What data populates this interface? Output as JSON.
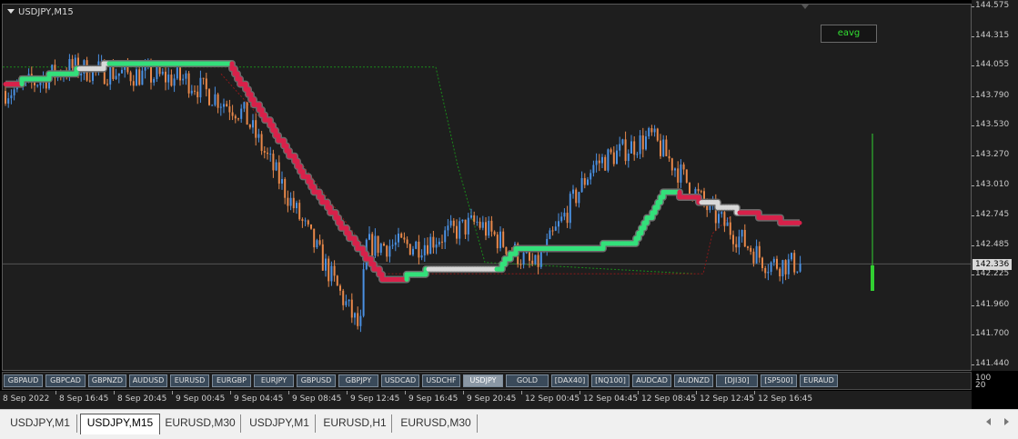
{
  "chart": {
    "title": "USDJPY,M15",
    "indicator_label": "eavg",
    "current_price": "142.336",
    "colors": {
      "background": "#1e1e1e",
      "bull_candle": "#4a90e2",
      "bear_candle": "#e8884a",
      "band_up": "#33e07a",
      "band_down": "#d8214a",
      "band_flat": "#d8d8d8",
      "envelope_green": "#1a8a1a",
      "envelope_red": "#8a1a1a",
      "volume_bar": "#32d032"
    }
  },
  "chart_data": {
    "type": "candlestick",
    "symbol": "USDJPY",
    "timeframe": "M15",
    "ylim": [
      141.44,
      144.575
    ],
    "price_ticks": [
      "144.575",
      "144.315",
      "144.055",
      "143.790",
      "143.530",
      "143.270",
      "143.010",
      "142.745",
      "142.485",
      "142.225",
      "141.960",
      "141.700",
      "141.440"
    ],
    "time_ticks": [
      "8 Sep 2022",
      "8 Sep 16:45",
      "8 Sep 20:45",
      "9 Sep 00:45",
      "9 Sep 04:45",
      "9 Sep 08:45",
      "9 Sep 12:45",
      "9 Sep 16:45",
      "9 Sep 20:45",
      "12 Sep 00:45",
      "12 Sep 04:45",
      "12 Sep 08:45",
      "12 Sep 12:45",
      "12 Sep 16:45"
    ],
    "close_path": [
      [
        "8 Sep 2022",
        143.85
      ],
      [
        "8 Sep 16:45",
        144.05
      ],
      [
        "8 Sep 20:45",
        144.0
      ],
      [
        "9 Sep 00:45",
        143.95
      ],
      [
        "9 Sep 04:45",
        143.65
      ],
      [
        "9 Sep 08:45",
        142.7
      ],
      [
        "9 Sep 12:45",
        141.75
      ],
      [
        "9 Sep 12:45",
        142.5
      ],
      [
        "9 Sep 16:45",
        142.5
      ],
      [
        "9 Sep 20:45",
        142.7
      ],
      [
        "12 Sep 00:45",
        142.3
      ],
      [
        "12 Sep 04:45",
        143.2
      ],
      [
        "12 Sep 08:45",
        143.45
      ],
      [
        "12 Sep 12:45",
        142.8
      ],
      [
        "12 Sep 16:45",
        142.336
      ]
    ],
    "band_path": [
      [
        "8 Sep 2022",
        143.92
      ],
      [
        "8 Sep 16:45",
        144.08
      ],
      [
        "9 Sep 04:45",
        144.08
      ],
      [
        "9 Sep 08:45",
        143.0
      ],
      [
        "9 Sep 12:45",
        142.18
      ],
      [
        "9 Sep 16:45",
        142.3
      ],
      [
        "9 Sep 20:45",
        142.3
      ],
      [
        "12 Sep 00:45",
        142.47
      ],
      [
        "12 Sep 04:45",
        142.5
      ],
      [
        "12 Sep 08:45",
        142.97
      ],
      [
        "12 Sep 12:45",
        142.8
      ],
      [
        "12 Sep 16:45",
        142.67
      ]
    ],
    "subwindow_scale": [
      "100",
      "20"
    ]
  },
  "symbols": [
    "GBPAUD",
    "GBPCAD",
    "GBPNZD",
    "AUDUSD",
    "EURUSD",
    "EURGBP",
    "EURJPY",
    "GBPUSD",
    "GBPJPY",
    "USDCAD",
    "USDCHF",
    "USDJPY",
    "GOLD",
    "[DAX40]",
    "[NQ100]",
    "AUDCAD",
    "AUDNZD",
    "[DJI30]",
    "[SP500]",
    "EURAUD"
  ],
  "active_symbol": "USDJPY",
  "tabs": [
    "USDJPY,M1",
    "USDJPY,M15",
    "EURUSD,M30",
    "USDJPY,M1",
    "EURUSD,H1",
    "EURUSD,M30"
  ],
  "active_tab": 1
}
